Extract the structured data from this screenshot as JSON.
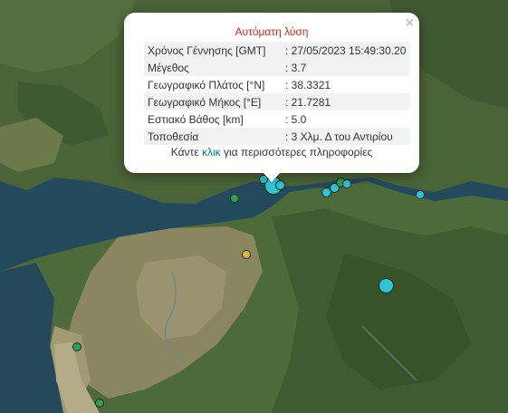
{
  "popup": {
    "title": "Αυτόματη λύση",
    "close_symbol": "×",
    "rows": [
      {
        "label": "Χρόνος Γέννησης [GMT]",
        "value": ": 27/05/2023 15:49:30.20"
      },
      {
        "label": "Μέγεθος",
        "value": ": 3.7"
      },
      {
        "label": "Γεωγραφικό Πλάτος [°N]",
        "value": ": 38.3321"
      },
      {
        "label": "Γεωγραφικό Μήκος [°E]",
        "value": ": 21.7281"
      },
      {
        "label": "Εστιακό Βάθος [km]",
        "value": ": 5.0"
      },
      {
        "label": "Τοποθεσία",
        "value": ": 3 Χλμ. Δ του Αντιρίου"
      }
    ],
    "more_prefix": "Κάντε",
    "more_link": "κλικ",
    "more_suffix": "για περισσότερες πληροφορίες"
  },
  "colors": {
    "recent_marker": "#2ec4d8",
    "green_marker": "#2f9d55",
    "yellow_marker": "#e2b533",
    "sea": "#234a5c",
    "land": "#4c6636",
    "title_red": "#e0211d",
    "link_blue": "#0078a8"
  },
  "icons": {
    "close": "close-icon",
    "marker": "earthquake-marker-icon"
  }
}
